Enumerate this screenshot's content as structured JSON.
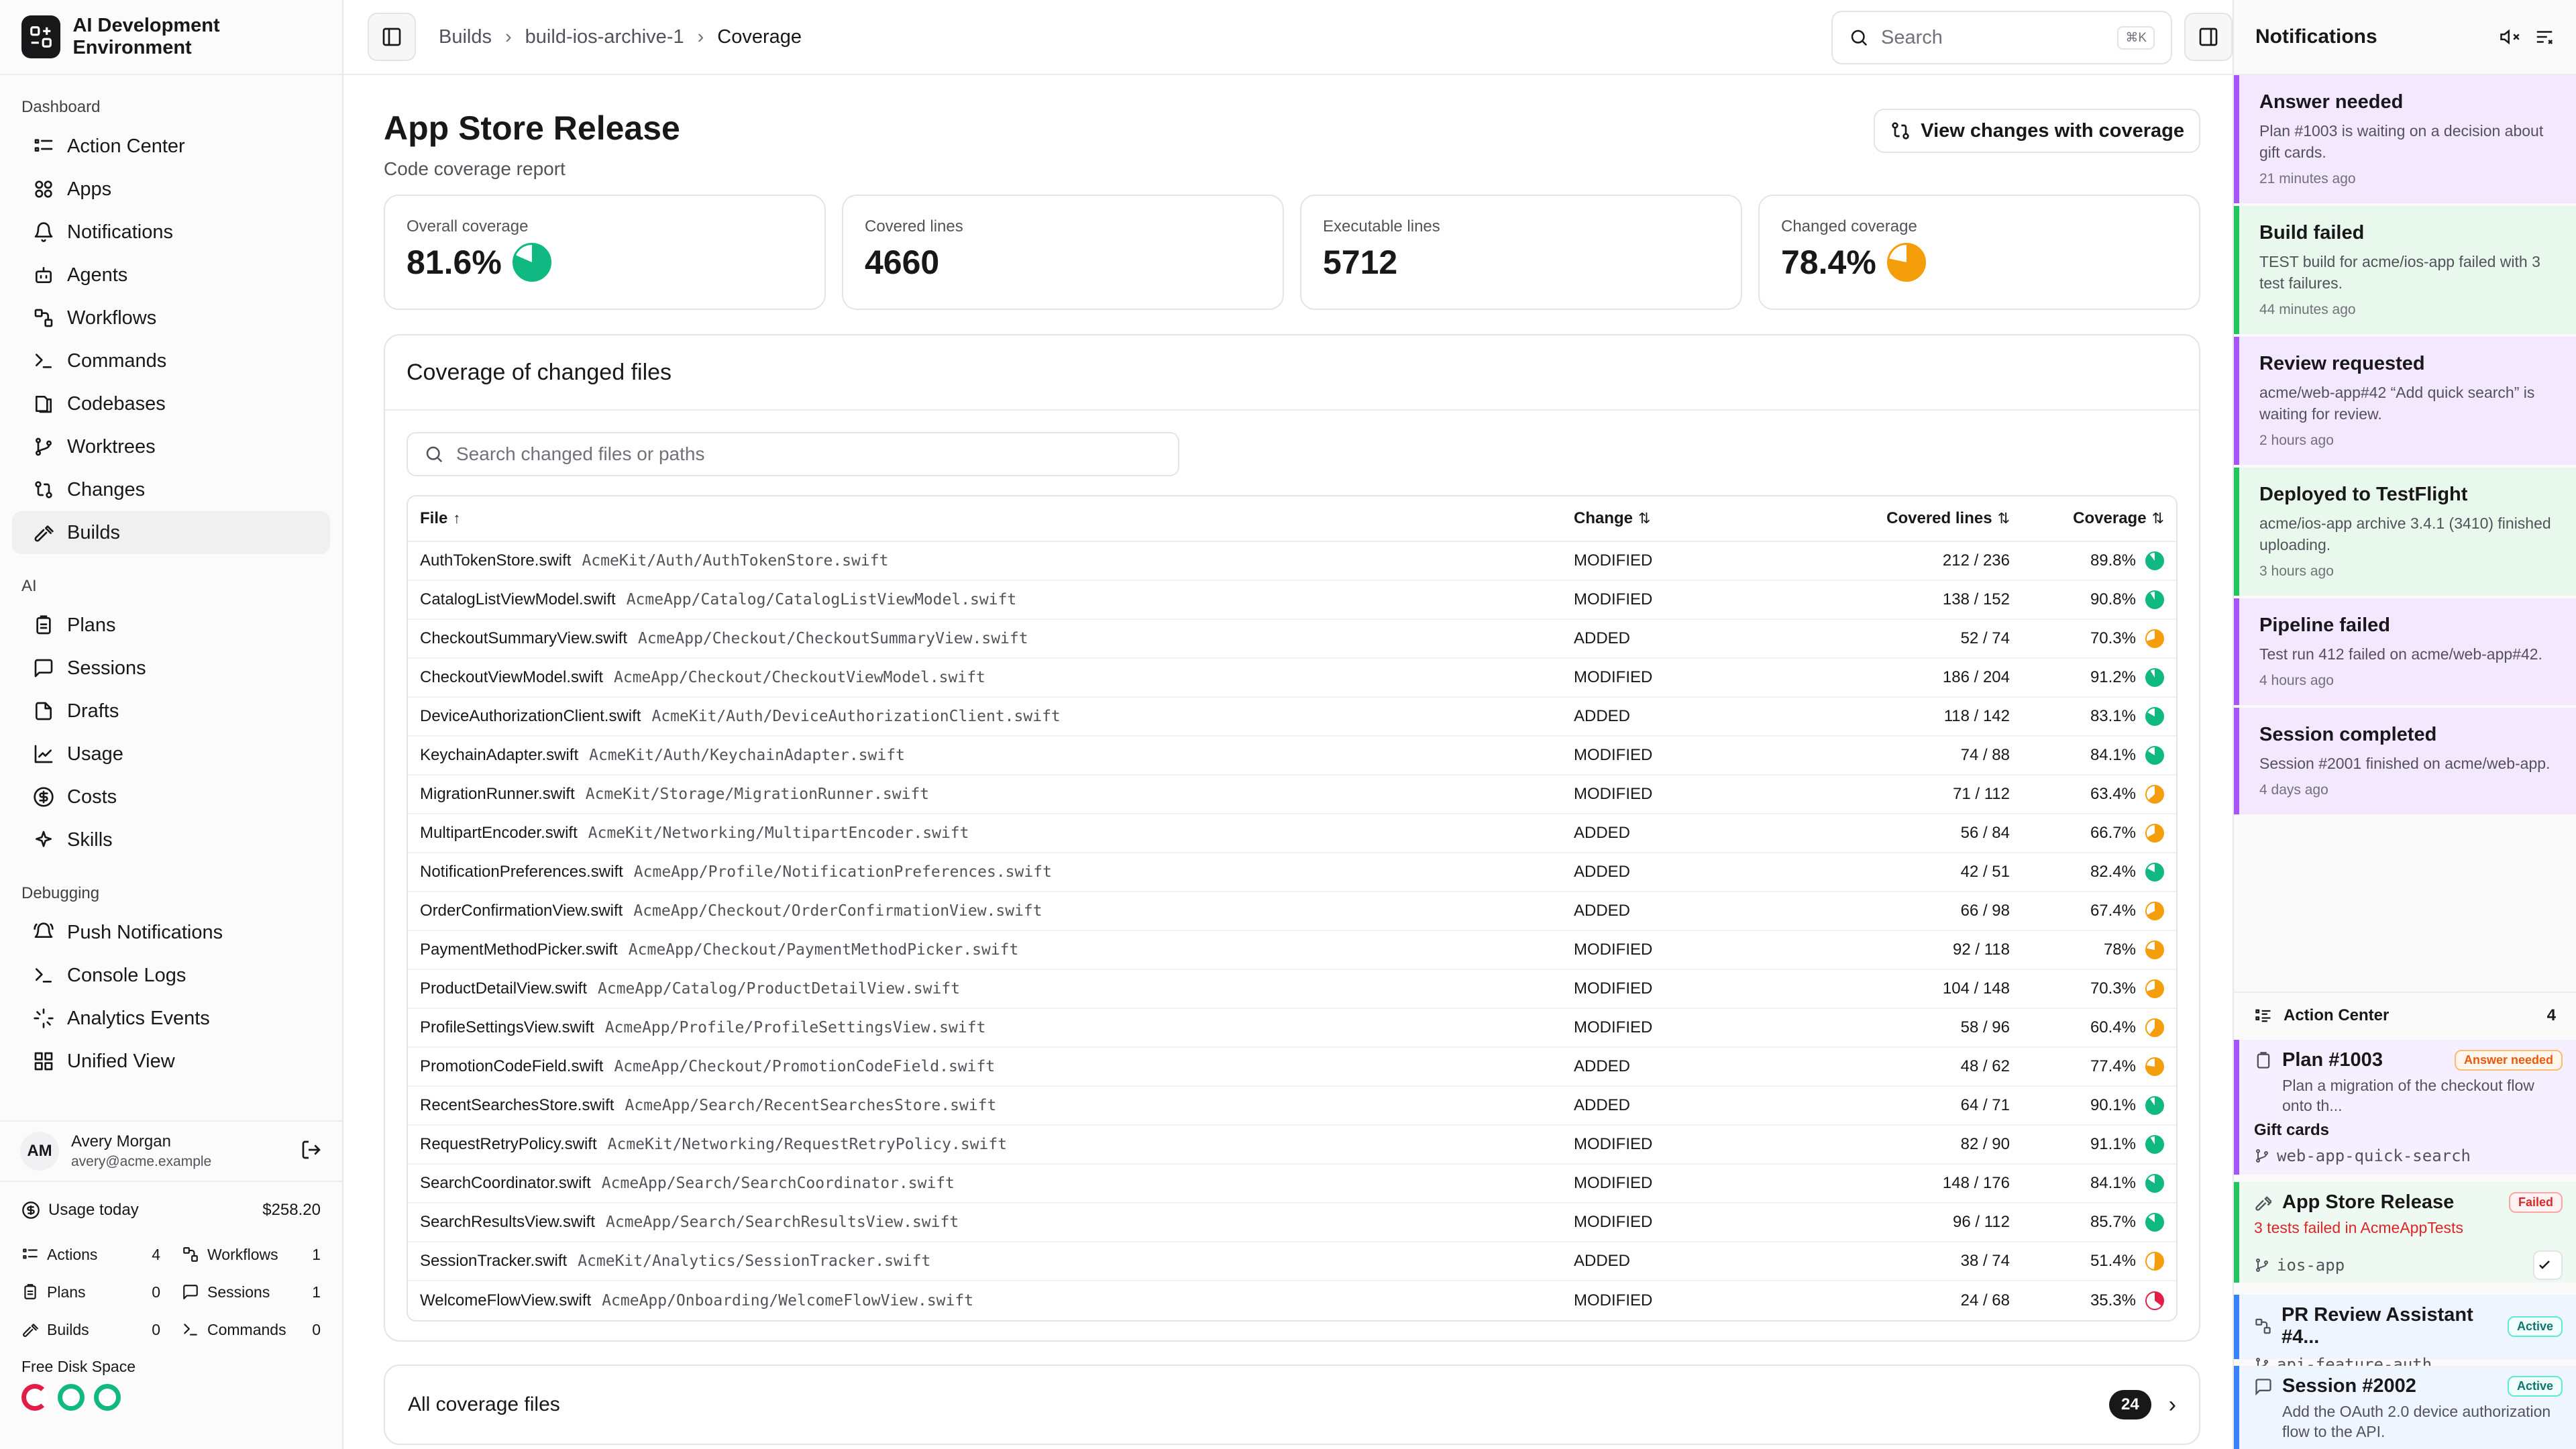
{
  "app": {
    "name": "AI Development Environment"
  },
  "sidebar": {
    "dashboard_label": "Dashboard",
    "dashboard_items": [
      {
        "label": "Action Center",
        "icon": "checklist-icon"
      },
      {
        "label": "Apps",
        "icon": "apps-icon"
      },
      {
        "label": "Notifications",
        "icon": "bell-icon"
      },
      {
        "label": "Agents",
        "icon": "bot-icon"
      },
      {
        "label": "Workflows",
        "icon": "workflow-icon"
      },
      {
        "label": "Commands",
        "icon": "terminal-icon"
      },
      {
        "label": "Codebases",
        "icon": "codebase-icon"
      },
      {
        "label": "Worktrees",
        "icon": "branch-icon"
      },
      {
        "label": "Changes",
        "icon": "changes-icon"
      },
      {
        "label": "Builds",
        "icon": "hammer-icon",
        "active": true
      }
    ],
    "ai_label": "AI",
    "ai_items": [
      {
        "label": "Plans",
        "icon": "clipboard-icon"
      },
      {
        "label": "Sessions",
        "icon": "sessions-icon"
      },
      {
        "label": "Drafts",
        "icon": "drafts-icon"
      },
      {
        "label": "Usage",
        "icon": "chart-icon"
      },
      {
        "label": "Costs",
        "icon": "dollar-icon"
      },
      {
        "label": "Skills",
        "icon": "sparkle-icon"
      }
    ],
    "debug_label": "Debugging",
    "debug_items": [
      {
        "label": "Push Notifications",
        "icon": "bell-ring-icon"
      },
      {
        "label": "Console Logs",
        "icon": "terminal-icon"
      },
      {
        "label": "Analytics Events",
        "icon": "analytics-icon"
      },
      {
        "label": "Unified View",
        "icon": "grid-icon"
      }
    ],
    "user": {
      "initials": "AM",
      "name": "Avery Morgan",
      "email": "avery@acme.example"
    },
    "usage": {
      "label": "Usage today",
      "amount": "$258.20",
      "stats": [
        {
          "label": "Actions",
          "value": "4"
        },
        {
          "label": "Workflows",
          "value": "1"
        },
        {
          "label": "Plans",
          "value": "0"
        },
        {
          "label": "Sessions",
          "value": "1"
        },
        {
          "label": "Builds",
          "value": "0"
        },
        {
          "label": "Commands",
          "value": "0"
        }
      ]
    },
    "disk": {
      "label": "Free Disk Space",
      "levels": [
        0.05,
        0.85,
        0.6
      ],
      "colors": [
        "#e11d48",
        "#10b981",
        "#10b981"
      ]
    }
  },
  "topbar": {
    "breadcrumbs": [
      "Builds",
      "build-ios-archive-1",
      "Coverage"
    ],
    "search_placeholder": "Search",
    "search_shortcut": "⌘K"
  },
  "page": {
    "title": "App Store Release",
    "subtitle": "Code coverage report",
    "view_button": "View changes with coverage",
    "cards": [
      {
        "label": "Overall coverage",
        "value": "81.6%",
        "pie": 0.816,
        "color": "#10b981"
      },
      {
        "label": "Covered lines",
        "value": "4660"
      },
      {
        "label": "Executable lines",
        "value": "5712"
      },
      {
        "label": "Changed coverage",
        "value": "78.4%",
        "pie": 0.784,
        "color": "#f59e0b"
      }
    ],
    "changed": {
      "title": "Coverage of changed files",
      "search_placeholder": "Search changed files or paths",
      "columns": {
        "file": "File",
        "change": "Change",
        "lines": "Covered lines",
        "coverage": "Coverage"
      },
      "rows": [
        {
          "file": "AuthTokenStore.swift",
          "path": "AcmeKit/Auth/AuthTokenStore.swift",
          "change": "MODIFIED",
          "lines": "212 / 236",
          "coverage": "89.8%",
          "pct": 0.898
        },
        {
          "file": "CatalogListViewModel.swift",
          "path": "AcmeApp/Catalog/CatalogListViewModel.swift",
          "change": "MODIFIED",
          "lines": "138 / 152",
          "coverage": "90.8%",
          "pct": 0.908
        },
        {
          "file": "CheckoutSummaryView.swift",
          "path": "AcmeApp/Checkout/CheckoutSummaryView.swift",
          "change": "ADDED",
          "lines": "52 / 74",
          "coverage": "70.3%",
          "pct": 0.703
        },
        {
          "file": "CheckoutViewModel.swift",
          "path": "AcmeApp/Checkout/CheckoutViewModel.swift",
          "change": "MODIFIED",
          "lines": "186 / 204",
          "coverage": "91.2%",
          "pct": 0.912
        },
        {
          "file": "DeviceAuthorizationClient.swift",
          "path": "AcmeKit/Auth/DeviceAuthorizationClient.swift",
          "change": "ADDED",
          "lines": "118 / 142",
          "coverage": "83.1%",
          "pct": 0.831
        },
        {
          "file": "KeychainAdapter.swift",
          "path": "AcmeKit/Auth/KeychainAdapter.swift",
          "change": "MODIFIED",
          "lines": "74 / 88",
          "coverage": "84.1%",
          "pct": 0.841
        },
        {
          "file": "MigrationRunner.swift",
          "path": "AcmeKit/Storage/MigrationRunner.swift",
          "change": "MODIFIED",
          "lines": "71 / 112",
          "coverage": "63.4%",
          "pct": 0.634
        },
        {
          "file": "MultipartEncoder.swift",
          "path": "AcmeKit/Networking/MultipartEncoder.swift",
          "change": "ADDED",
          "lines": "56 / 84",
          "coverage": "66.7%",
          "pct": 0.667
        },
        {
          "file": "NotificationPreferences.swift",
          "path": "AcmeApp/Profile/NotificationPreferences.swift",
          "change": "ADDED",
          "lines": "42 / 51",
          "coverage": "82.4%",
          "pct": 0.824
        },
        {
          "file": "OrderConfirmationView.swift",
          "path": "AcmeApp/Checkout/OrderConfirmationView.swift",
          "change": "ADDED",
          "lines": "66 / 98",
          "coverage": "67.4%",
          "pct": 0.674
        },
        {
          "file": "PaymentMethodPicker.swift",
          "path": "AcmeApp/Checkout/PaymentMethodPicker.swift",
          "change": "MODIFIED",
          "lines": "92 / 118",
          "coverage": "78%",
          "pct": 0.78
        },
        {
          "file": "ProductDetailView.swift",
          "path": "AcmeApp/Catalog/ProductDetailView.swift",
          "change": "MODIFIED",
          "lines": "104 / 148",
          "coverage": "70.3%",
          "pct": 0.703
        },
        {
          "file": "ProfileSettingsView.swift",
          "path": "AcmeApp/Profile/ProfileSettingsView.swift",
          "change": "MODIFIED",
          "lines": "58 / 96",
          "coverage": "60.4%",
          "pct": 0.604
        },
        {
          "file": "PromotionCodeField.swift",
          "path": "AcmeApp/Checkout/PromotionCodeField.swift",
          "change": "ADDED",
          "lines": "48 / 62",
          "coverage": "77.4%",
          "pct": 0.774
        },
        {
          "file": "RecentSearchesStore.swift",
          "path": "AcmeApp/Search/RecentSearchesStore.swift",
          "change": "ADDED",
          "lines": "64 / 71",
          "coverage": "90.1%",
          "pct": 0.901
        },
        {
          "file": "RequestRetryPolicy.swift",
          "path": "AcmeKit/Networking/RequestRetryPolicy.swift",
          "change": "MODIFIED",
          "lines": "82 / 90",
          "coverage": "91.1%",
          "pct": 0.911
        },
        {
          "file": "SearchCoordinator.swift",
          "path": "AcmeApp/Search/SearchCoordinator.swift",
          "change": "MODIFIED",
          "lines": "148 / 176",
          "coverage": "84.1%",
          "pct": 0.841
        },
        {
          "file": "SearchResultsView.swift",
          "path": "AcmeApp/Search/SearchResultsView.swift",
          "change": "MODIFIED",
          "lines": "96 / 112",
          "coverage": "85.7%",
          "pct": 0.857
        },
        {
          "file": "SessionTracker.swift",
          "path": "AcmeKit/Analytics/SessionTracker.swift",
          "change": "ADDED",
          "lines": "38 / 74",
          "coverage": "51.4%",
          "pct": 0.514
        },
        {
          "file": "WelcomeFlowView.swift",
          "path": "AcmeApp/Onboarding/WelcomeFlowView.swift",
          "change": "MODIFIED",
          "lines": "24 / 68",
          "coverage": "35.3%",
          "pct": 0.353
        }
      ]
    },
    "all_files": {
      "label": "All coverage files",
      "count": "24"
    }
  },
  "notifications": {
    "title": "Notifications",
    "items": [
      {
        "title": "Answer needed",
        "body": "Plan #1003 is waiting on a decision about gift cards.",
        "time": "21 minutes ago",
        "color": "#a855f7",
        "bg": "#f3e8ff"
      },
      {
        "title": "Build failed",
        "body": "TEST build for acme/ios-app failed with 3 test failures.",
        "time": "44 minutes ago",
        "color": "#22c55e",
        "bg": "#e8f8ec"
      },
      {
        "title": "Review requested",
        "body": "acme/web-app#42 “Add quick search” is waiting for review.",
        "time": "2 hours ago",
        "color": "#a855f7",
        "bg": "#f3e8ff"
      },
      {
        "title": "Deployed to TestFlight",
        "body": "acme/ios-app archive 3.4.1 (3410) finished uploading.",
        "time": "3 hours ago",
        "color": "#22c55e",
        "bg": "#e8f8ec"
      },
      {
        "title": "Pipeline failed",
        "body": "Test run 412 failed on acme/web-app#42.",
        "time": "4 hours ago",
        "color": "#a855f7",
        "bg": "#f3e8ff"
      },
      {
        "title": "Session completed",
        "body": "Session #2001 finished on acme/web-app.",
        "time": "4 days ago",
        "color": "#a855f7",
        "bg": "#f3e8ff"
      }
    ]
  },
  "action_center": {
    "title": "Action Center",
    "count": "4",
    "items": [
      {
        "title": "Plan #1003",
        "badge": "Answer needed",
        "sub": "Plan a migration of the checkout flow onto th...",
        "extra": "Gift cards",
        "branch": "web-app-quick-search"
      },
      {
        "title": "App Store Release",
        "badge": "Failed",
        "sub": "3 tests failed in AcmeAppTests",
        "branch": "ios-app"
      },
      {
        "title": "PR Review Assistant #4...",
        "badge": "Active",
        "branch": "api-feature-auth"
      },
      {
        "title": "Session #2002",
        "badge": "Active",
        "sub": "Add the OAuth 2.0 device authorization flow to the API."
      }
    ]
  }
}
